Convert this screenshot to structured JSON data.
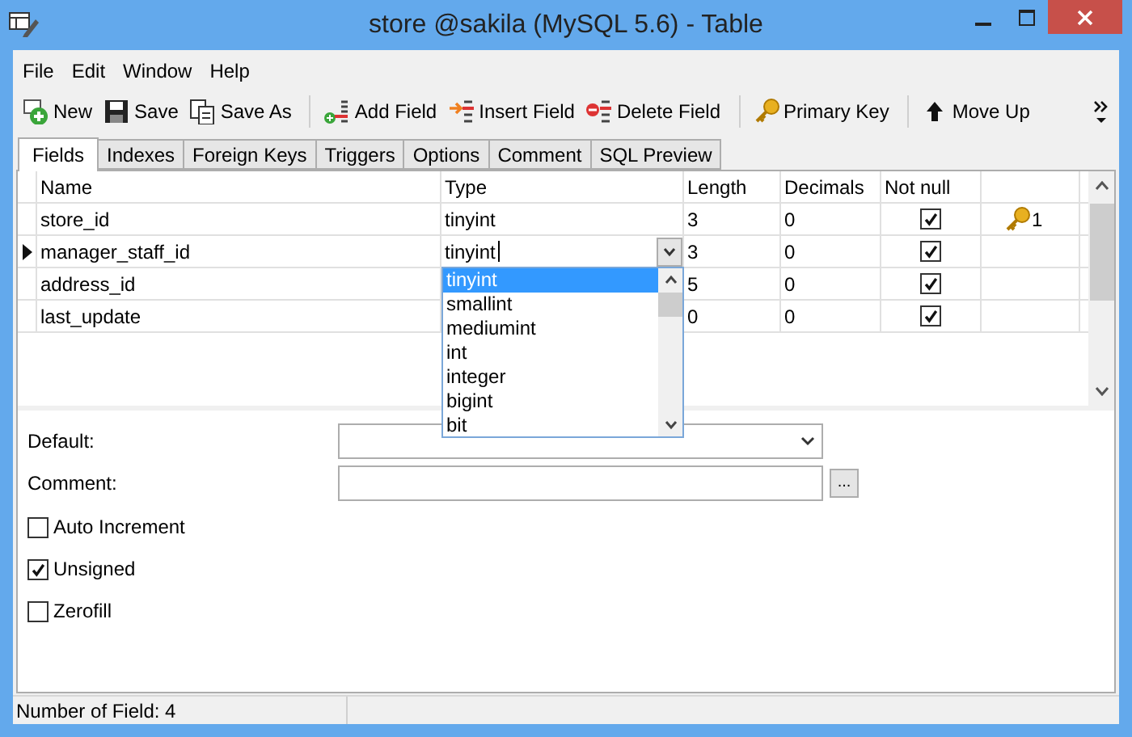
{
  "window": {
    "title": "store @sakila (MySQL 5.6) - Table"
  },
  "menu": [
    "File",
    "Edit",
    "Window",
    "Help"
  ],
  "toolbar": [
    {
      "kind": "new",
      "label": "New"
    },
    {
      "kind": "save",
      "label": "Save"
    },
    {
      "kind": "save_as",
      "label": "Save As"
    },
    {
      "kind": "add_field",
      "label": "Add Field"
    },
    {
      "kind": "insert_field",
      "label": "Insert Field"
    },
    {
      "kind": "delete_field",
      "label": "Delete Field"
    },
    {
      "kind": "primary_key",
      "label": "Primary Key"
    },
    {
      "kind": "move_up",
      "label": "Move Up"
    }
  ],
  "tabs": [
    {
      "label": "Fields",
      "selected": true
    },
    {
      "label": "Indexes",
      "selected": false
    },
    {
      "label": "Foreign Keys",
      "selected": false
    },
    {
      "label": "Triggers",
      "selected": false
    },
    {
      "label": "Options",
      "selected": false
    },
    {
      "label": "Comment",
      "selected": false
    },
    {
      "label": "SQL Preview",
      "selected": false
    }
  ],
  "table": {
    "columns": [
      "Name",
      "Type",
      "Length",
      "Decimals",
      "Not null"
    ],
    "rows": [
      {
        "name": "store_id",
        "type": "tinyint",
        "length": "3",
        "decimals": "0",
        "not_null": true,
        "current": false,
        "editing": false,
        "primary_key": true,
        "key_order": "1"
      },
      {
        "name": "manager_staff_id",
        "type": "tinyint",
        "length": "3",
        "decimals": "0",
        "not_null": true,
        "current": true,
        "editing": true,
        "primary_key": false
      },
      {
        "name": "address_id",
        "length": "5",
        "decimals": "0",
        "not_null": true,
        "current": false,
        "editing": false,
        "primary_key": false
      },
      {
        "name": "last_update",
        "length": "0",
        "decimals": "0",
        "not_null": true,
        "current": false,
        "editing": false,
        "primary_key": false
      }
    ]
  },
  "type_dropdown": {
    "options": [
      {
        "label": "tinyint",
        "selected": true
      },
      {
        "label": "smallint",
        "selected": false
      },
      {
        "label": "mediumint",
        "selected": false
      },
      {
        "label": "int",
        "selected": false
      },
      {
        "label": "integer",
        "selected": false
      },
      {
        "label": "bigint",
        "selected": false
      },
      {
        "label": "bit",
        "selected": false
      }
    ]
  },
  "properties": {
    "default_label": "Default:",
    "comment_label": "Comment:",
    "ellipsis": "...",
    "options": [
      {
        "label": "Auto Increment",
        "checked": false
      },
      {
        "label": "Unsigned",
        "checked": true
      },
      {
        "label": "Zerofill",
        "checked": false
      }
    ]
  },
  "status_bar": "Number of Field: 4"
}
